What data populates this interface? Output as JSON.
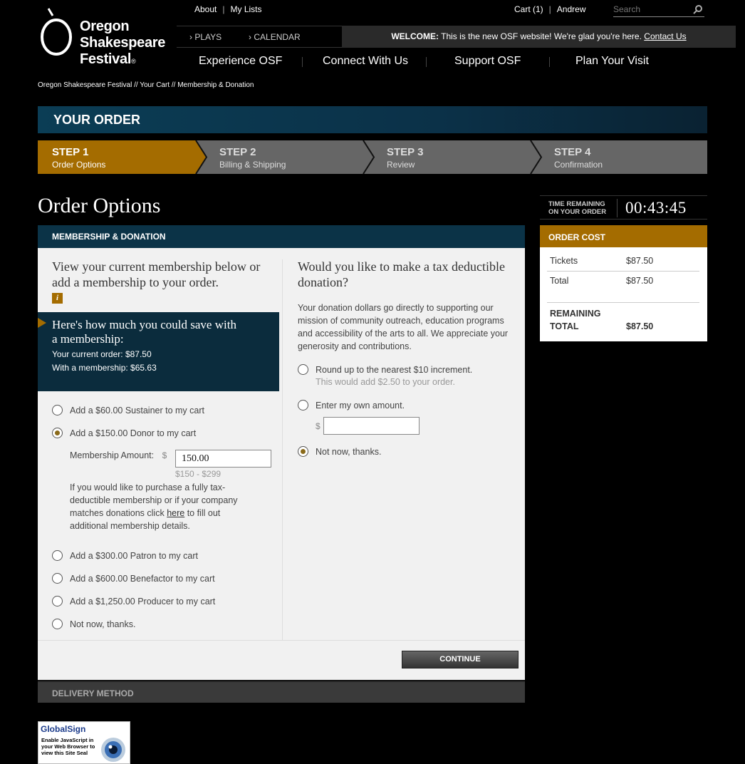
{
  "logo": {
    "line1": "Oregon",
    "line2": "Shakespeare",
    "line3": "Festival",
    "reg": "®"
  },
  "toplinks": {
    "about": "About",
    "mylists": "My Lists",
    "cart": "Cart (1)",
    "user": "Andrew"
  },
  "search": {
    "placeholder": "Search"
  },
  "subnav": {
    "plays": "PLAYS",
    "calendar": "CALENDAR"
  },
  "welcome": {
    "bold": "WELCOME:",
    "text": " This is the new OSF website! We're glad you're here. ",
    "link": "Contact Us"
  },
  "mainnav": [
    "Experience OSF",
    "Connect With Us",
    "Support OSF",
    "Plan Your Visit"
  ],
  "breadcrumb": "Oregon Shakespeare Festival // Your Cart // Membership & Donation",
  "your_order": "YOUR ORDER",
  "steps": [
    {
      "title": "STEP 1",
      "sub": "Order Options"
    },
    {
      "title": "STEP 2",
      "sub": "Billing & Shipping"
    },
    {
      "title": "STEP 3",
      "sub": "Review"
    },
    {
      "title": "STEP 4",
      "sub": "Confirmation"
    }
  ],
  "colors": {
    "accent_gold": "#a46c00",
    "navy": "#0b3347",
    "step_inactive": "#666666"
  },
  "page_title": "Order Options",
  "membership": {
    "header": "MEMBERSHIP & DONATION",
    "question": "View your current membership below or add a membership to your order.",
    "info_icon": "i",
    "save_heading": "Here's how much you could save with a membership:",
    "current_order": "Your current order: $87.50",
    "with_membership": "With a membership: $65.63",
    "options": [
      {
        "label": "Add a $60.00 Sustainer to my cart",
        "selected": false
      },
      {
        "label": "Add a $150.00 Donor to my cart",
        "selected": true
      },
      {
        "label": "Add a $300.00 Patron to my cart",
        "selected": false
      },
      {
        "label": "Add a $600.00 Benefactor to my cart",
        "selected": false
      },
      {
        "label": "Add a $1,250.00 Producer to my cart",
        "selected": false
      },
      {
        "label": "Not now, thanks.",
        "selected": false
      }
    ],
    "amount_label": "Membership Amount:",
    "currency": "$",
    "amount_value": "150.00",
    "amount_range": "$150 - $299",
    "note_before": "If you would like to purchase a fully tax-deductible membership or if your company matches donations click ",
    "note_link": "here",
    "note_after": " to fill out additional membership details."
  },
  "donation": {
    "question": "Would you like to make a tax deductible donation?",
    "description": "Your donation dollars go directly to supporting our mission of community outreach, education programs and accessibility of the arts to all. We appreciate your generosity and contributions.",
    "options": [
      {
        "label": "Round up to the nearest $10 increment.",
        "sub": "This would add $2.50 to your order.",
        "selected": false
      },
      {
        "label": "Enter my own amount.",
        "selected": false
      },
      {
        "label": "Not now, thanks.",
        "selected": true
      }
    ],
    "currency": "$",
    "own_amount": ""
  },
  "continue_label": "CONTINUE",
  "delivery_label": "DELIVERY METHOD",
  "timer": {
    "label_line1": "TIME REMAINING",
    "label_line2": "ON YOUR ORDER",
    "value": "00:43:45"
  },
  "order_cost": {
    "header": "ORDER COST",
    "tickets_label": "Tickets",
    "tickets_value": "$87.50",
    "total_label": "Total",
    "total_value": "$87.50",
    "remaining_label1": "REMAINING",
    "remaining_label2": "TOTAL",
    "remaining_value": "$87.50"
  },
  "seal": {
    "brand": "GlobalSign",
    "text": "Enable JavaScript in your Web Browser to view this Site Seal"
  }
}
